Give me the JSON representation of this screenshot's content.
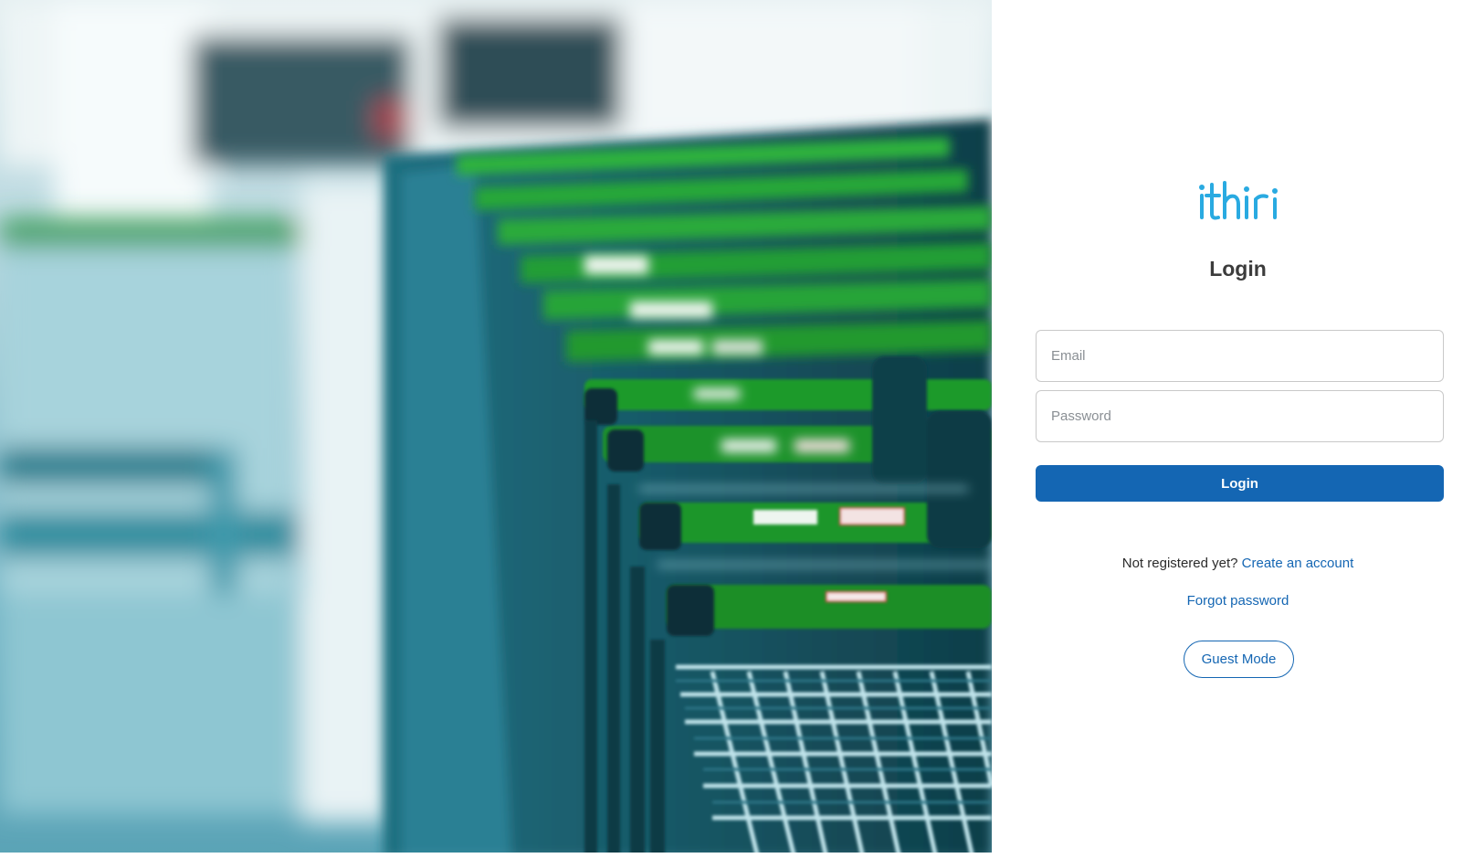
{
  "hero": {
    "description_icon": "shopping-carts-photo"
  },
  "brand": {
    "logo_text": "ithiri",
    "accent_color": "#29aae1"
  },
  "login_form": {
    "title": "Login",
    "email_placeholder": "Email",
    "password_placeholder": "Password",
    "submit_label": "Login",
    "submit_color": "#1466b3",
    "register_prompt": "Not registered yet?",
    "register_link": "Create an account",
    "forgot_link": "Forgot password",
    "guest_label": "Guest Mode"
  }
}
